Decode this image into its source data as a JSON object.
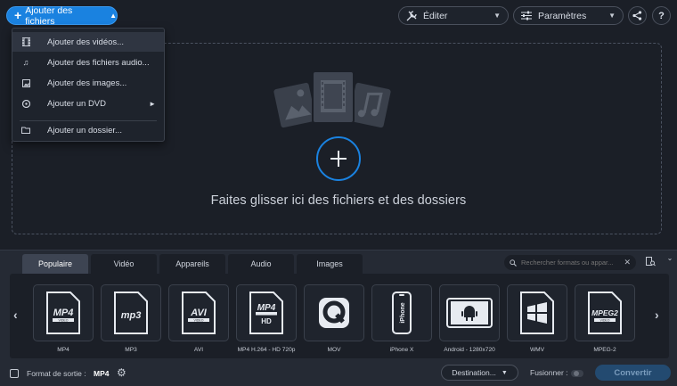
{
  "toolbar": {
    "add_files_label": "Ajouter des fichiers",
    "edit_label": "Éditer",
    "settings_label": "Paramètres",
    "help_label": "?"
  },
  "add_menu": {
    "items": [
      {
        "label": "Ajouter des vidéos...",
        "icon": "film-icon",
        "highlighted": true
      },
      {
        "label": "Ajouter des fichiers audio...",
        "icon": "music-note-icon"
      },
      {
        "label": "Ajouter des images...",
        "icon": "image-icon"
      },
      {
        "label": "Ajouter un DVD",
        "icon": "disc-icon",
        "has_submenu": true
      },
      {
        "label": "Ajouter un dossier...",
        "icon": "folder-icon"
      }
    ]
  },
  "dropzone": {
    "text": "Faites glisser ici des fichiers et des dossiers"
  },
  "format_panel": {
    "tabs": [
      {
        "label": "Populaire",
        "active": true
      },
      {
        "label": "Vidéo"
      },
      {
        "label": "Appareils"
      },
      {
        "label": "Audio"
      },
      {
        "label": "Images"
      }
    ],
    "search_placeholder": "Rechercher formats ou appar...",
    "formats": [
      {
        "label": "MP4",
        "badge": "MP4",
        "sub": "VIDEO"
      },
      {
        "label": "MP3",
        "badge": "mp3",
        "sub": ""
      },
      {
        "label": "AVI",
        "badge": "AVI",
        "sub": "VIDEO"
      },
      {
        "label": "MP4 H.264 - HD 720p",
        "badge": "MP4",
        "sub": "HD"
      },
      {
        "label": "MOV",
        "badge": "",
        "sub": ""
      },
      {
        "label": "iPhone X",
        "badge": "iPhone",
        "sub": ""
      },
      {
        "label": "Android - 1280x720",
        "badge": "",
        "sub": ""
      },
      {
        "label": "WMV",
        "badge": "",
        "sub": ""
      },
      {
        "label": "MPEG-2",
        "badge": "MPEG2",
        "sub": "VIDEO"
      }
    ]
  },
  "status_bar": {
    "output_format_label": "Format de sortie :",
    "output_format_value": "MP4",
    "destination_label": "Destination...",
    "merge_label": "Fusionner :",
    "merge_on": false,
    "convert_label": "Convertir"
  },
  "colors": {
    "accent": "#1a82e0",
    "background": "#1b1f27",
    "panel": "#252a34"
  }
}
